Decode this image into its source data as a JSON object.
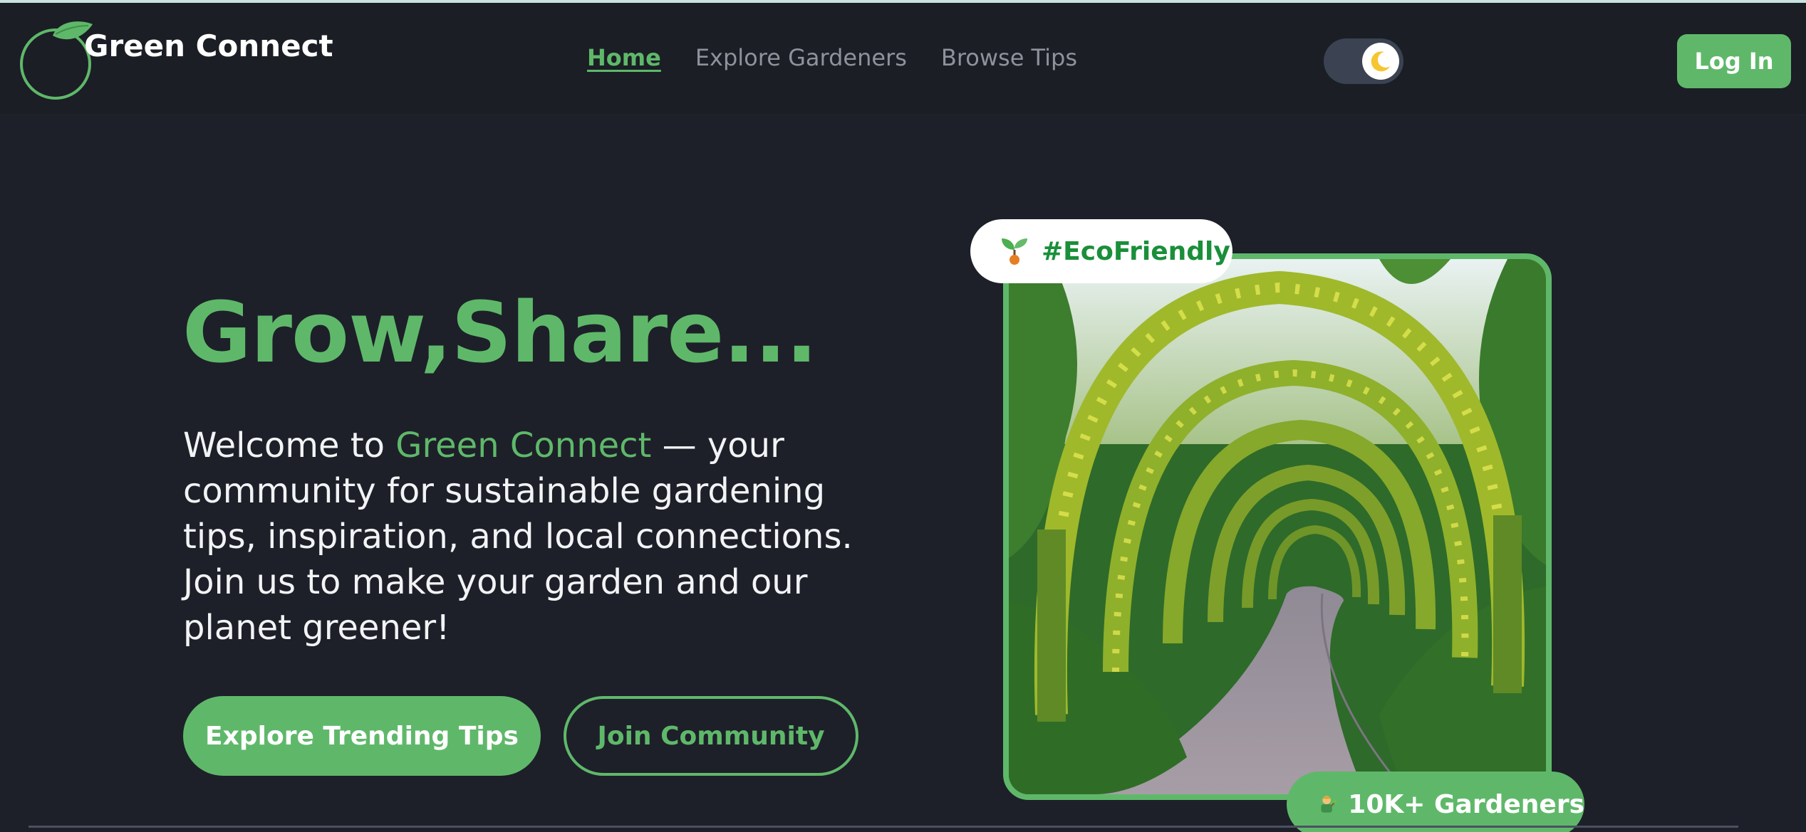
{
  "brand": {
    "name": "Green Connect",
    "accent_color": "#5fb86a",
    "logo_icon": "leaf-circle-logo"
  },
  "nav": {
    "items": [
      {
        "label": "Home",
        "active": true
      },
      {
        "label": "Explore Gardeners",
        "active": false
      },
      {
        "label": "Browse Tips",
        "active": false
      }
    ],
    "theme_toggle_icon": "moon-icon",
    "login_label": "Log In"
  },
  "hero": {
    "title": "Grow,Share...",
    "intro_prefix": "Welcome to ",
    "intro_highlight": "Green Connect",
    "intro_suffix": " — your community for sustainable gardening tips, inspiration, and local connections. Join us to make your garden and our planet greener!",
    "primary_button": "Explore Trending Tips",
    "secondary_button": "Join Community"
  },
  "showcase": {
    "top_badge_icon": "seedling-icon",
    "top_badge_label": "#EcoFriendly",
    "bottom_badge_icon": "gardener-icon",
    "bottom_badge_label": "10K+ Gardeners",
    "image_subject": "garden-archway-path"
  },
  "colors": {
    "background": "#1d2029",
    "navbar": "#1b1e25",
    "accent": "#5fb86a",
    "badge_text": "#1a8f3a",
    "muted_nav": "#8d929c"
  }
}
